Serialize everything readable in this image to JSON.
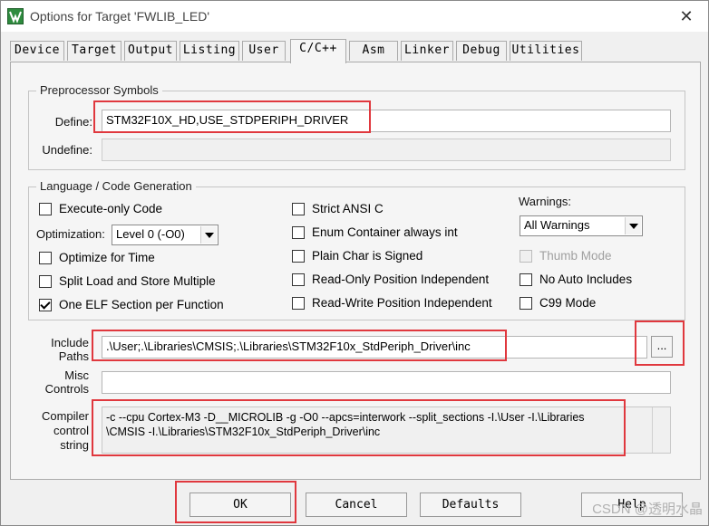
{
  "window": {
    "title": "Options for Target 'FWLIB_LED'",
    "close_label": "✕"
  },
  "tabs": [
    {
      "label": "Device"
    },
    {
      "label": "Target"
    },
    {
      "label": "Output"
    },
    {
      "label": "Listing"
    },
    {
      "label": "User"
    },
    {
      "label": "C/C++"
    },
    {
      "label": "Asm"
    },
    {
      "label": "Linker"
    },
    {
      "label": "Debug"
    },
    {
      "label": "Utilities"
    }
  ],
  "preprocessor": {
    "group_title": "Preprocessor Symbols",
    "define_label": "Define:",
    "define_value": "STM32F10X_HD,USE_STDPERIPH_DRIVER",
    "undefine_label": "Undefine:",
    "undefine_value": ""
  },
  "language": {
    "group_title": "Language / Code Generation",
    "execute_only": {
      "label": "Execute-only Code",
      "checked": false
    },
    "optimization_label": "Optimization:",
    "optimization_value": "Level 0 (-O0)",
    "optimize_time": {
      "label": "Optimize for Time",
      "checked": false
    },
    "split_load": {
      "label": "Split Load and Store Multiple",
      "checked": false
    },
    "one_elf": {
      "label": "One ELF Section per Function",
      "checked": true
    },
    "strict_ansi": {
      "label": "Strict ANSI C",
      "checked": false
    },
    "enum_container": {
      "label": "Enum Container always int",
      "checked": false
    },
    "plain_char": {
      "label": "Plain Char is Signed",
      "checked": false
    },
    "ro_position": {
      "label": "Read-Only Position Independent",
      "checked": false
    },
    "rw_position": {
      "label": "Read-Write Position Independent",
      "checked": false
    },
    "warnings_label": "Warnings:",
    "warnings_value": "All Warnings",
    "thumb_mode": {
      "label": "Thumb Mode",
      "checked": false
    },
    "no_auto_includes": {
      "label": "No Auto Includes",
      "checked": false
    },
    "c99_mode": {
      "label": "C99 Mode",
      "checked": false
    }
  },
  "include": {
    "label_line1": "Include",
    "label_line2": "Paths",
    "value": ".\\User;.\\Libraries\\CMSIS;.\\Libraries\\STM32F10x_StdPeriph_Driver\\inc",
    "browse_label": "..."
  },
  "misc": {
    "label_line1": "Misc",
    "label_line2": "Controls",
    "value": ""
  },
  "compiler": {
    "label_line1": "Compiler",
    "label_line2": "control",
    "label_line3": "string",
    "line1": "-c --cpu Cortex-M3 -D__MICROLIB -g -O0 --apcs=interwork --split_sections -I.\\User -I.\\Libraries",
    "line2": "\\CMSIS -I.\\Libraries\\STM32F10x_StdPeriph_Driver\\inc"
  },
  "buttons": {
    "ok": "OK",
    "cancel": "Cancel",
    "defaults": "Defaults",
    "help": "Help"
  },
  "watermark": "CSDN @透明水晶",
  "colors": {
    "highlight_box": "#e0383e",
    "app_icon": "#2e8b3e"
  }
}
